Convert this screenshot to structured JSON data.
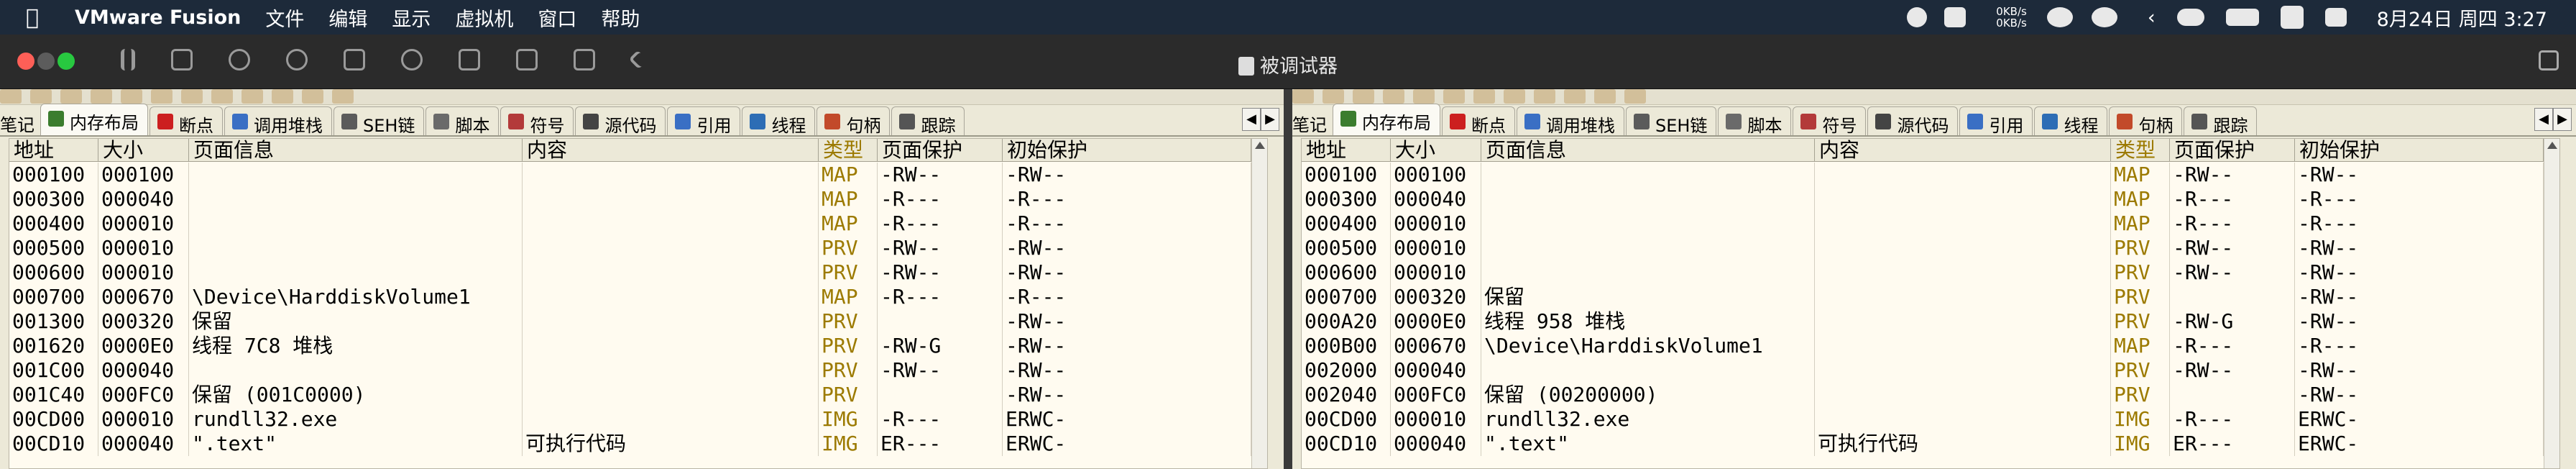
{
  "menubar": {
    "app_name": "VMware Fusion",
    "items": [
      "文件",
      "编辑",
      "显示",
      "虚拟机",
      "窗口",
      "帮助"
    ],
    "net_up": "0KB/s",
    "net_down": "0KB/s",
    "clock": "8月24日 周四 3:27"
  },
  "window": {
    "title": "被调试器"
  },
  "panels": [
    {
      "first_tab_label": "笔记",
      "tabs": [
        {
          "label": "内存布局",
          "active": true,
          "icon": "memory-icon",
          "color": "#3b7d2e"
        },
        {
          "label": "断点",
          "active": false,
          "icon": "breakpoint-icon",
          "color": "#cc1f1f"
        },
        {
          "label": "调用堆栈",
          "active": false,
          "icon": "callstack-icon",
          "color": "#3a6fc4"
        },
        {
          "label": "SEH链",
          "active": false,
          "icon": "seh-icon",
          "color": "#5b5b5b"
        },
        {
          "label": "脚本",
          "active": false,
          "icon": "script-icon",
          "color": "#6a6a6a"
        },
        {
          "label": "符号",
          "active": false,
          "icon": "symbol-icon",
          "color": "#b33a3a"
        },
        {
          "label": "源代码",
          "active": false,
          "icon": "source-icon",
          "color": "#444444"
        },
        {
          "label": "引用",
          "active": false,
          "icon": "reference-icon",
          "color": "#3a6fc4"
        },
        {
          "label": "线程",
          "active": false,
          "icon": "thread-icon",
          "color": "#2d6db5"
        },
        {
          "label": "句柄",
          "active": false,
          "icon": "handle-icon",
          "color": "#c24a2a"
        },
        {
          "label": "跟踪",
          "active": false,
          "icon": "trace-icon",
          "color": "#555555"
        }
      ],
      "columns": [
        "地址",
        "大小",
        "页面信息",
        "内容",
        "类型",
        "页面保护",
        "初始保护"
      ],
      "rows": [
        [
          "000100",
          "000100",
          "",
          "",
          "MAP",
          "-RW--",
          "-RW--"
        ],
        [
          "000300",
          "000040",
          "",
          "",
          "MAP",
          "-R---",
          "-R---"
        ],
        [
          "000400",
          "000010",
          "",
          "",
          "MAP",
          "-R---",
          "-R---"
        ],
        [
          "000500",
          "000010",
          "",
          "",
          "PRV",
          "-RW--",
          "-RW--"
        ],
        [
          "000600",
          "000010",
          "",
          "",
          "PRV",
          "-RW--",
          "-RW--"
        ],
        [
          "000700",
          "000670",
          "\\Device\\HarddiskVolume1",
          "",
          "MAP",
          "-R---",
          "-R---"
        ],
        [
          "001300",
          "000320",
          "保留",
          "",
          "PRV",
          "",
          "-RW--"
        ],
        [
          "001620",
          "0000E0",
          "线程 7C8 堆栈",
          "",
          "PRV",
          "-RW-G",
          "-RW--"
        ],
        [
          "001C00",
          "000040",
          "",
          "",
          "PRV",
          "-RW--",
          "-RW--"
        ],
        [
          "001C40",
          "000FC0",
          "保留 (001C0000)",
          "",
          "PRV",
          "",
          "-RW--"
        ],
        [
          "00CD00",
          "000010",
          "rundll32.exe",
          "",
          "IMG",
          "-R---",
          "ERWC-"
        ],
        [
          "00CD10",
          "000040",
          " \".text\"",
          "可执行代码",
          "IMG",
          "ER---",
          "ERWC-"
        ]
      ]
    },
    {
      "first_tab_label": "笔记",
      "tabs": [
        {
          "label": "内存布局",
          "active": true,
          "icon": "memory-icon",
          "color": "#3b7d2e"
        },
        {
          "label": "断点",
          "active": false,
          "icon": "breakpoint-icon",
          "color": "#cc1f1f"
        },
        {
          "label": "调用堆栈",
          "active": false,
          "icon": "callstack-icon",
          "color": "#3a6fc4"
        },
        {
          "label": "SEH链",
          "active": false,
          "icon": "seh-icon",
          "color": "#5b5b5b"
        },
        {
          "label": "脚本",
          "active": false,
          "icon": "script-icon",
          "color": "#6a6a6a"
        },
        {
          "label": "符号",
          "active": false,
          "icon": "symbol-icon",
          "color": "#b33a3a"
        },
        {
          "label": "源代码",
          "active": false,
          "icon": "source-icon",
          "color": "#444444"
        },
        {
          "label": "引用",
          "active": false,
          "icon": "reference-icon",
          "color": "#3a6fc4"
        },
        {
          "label": "线程",
          "active": false,
          "icon": "thread-icon",
          "color": "#2d6db5"
        },
        {
          "label": "句柄",
          "active": false,
          "icon": "handle-icon",
          "color": "#c24a2a"
        },
        {
          "label": "跟踪",
          "active": false,
          "icon": "trace-icon",
          "color": "#555555"
        }
      ],
      "columns": [
        "地址",
        "大小",
        "页面信息",
        "内容",
        "类型",
        "页面保护",
        "初始保护"
      ],
      "rows": [
        [
          "000100",
          "000100",
          "",
          "",
          "MAP",
          "-RW--",
          "-RW--"
        ],
        [
          "000300",
          "000040",
          "",
          "",
          "MAP",
          "-R---",
          "-R---"
        ],
        [
          "000400",
          "000010",
          "",
          "",
          "MAP",
          "-R---",
          "-R---"
        ],
        [
          "000500",
          "000010",
          "",
          "",
          "PRV",
          "-RW--",
          "-RW--"
        ],
        [
          "000600",
          "000010",
          "",
          "",
          "PRV",
          "-RW--",
          "-RW--"
        ],
        [
          "000700",
          "000320",
          "保留",
          "",
          "PRV",
          "",
          "-RW--"
        ],
        [
          "000A20",
          "0000E0",
          "线程 958 堆栈",
          "",
          "PRV",
          "-RW-G",
          "-RW--"
        ],
        [
          "000B00",
          "000670",
          "\\Device\\HarddiskVolume1",
          "",
          "MAP",
          "-R---",
          "-R---"
        ],
        [
          "002000",
          "000040",
          "",
          "",
          "PRV",
          "-RW--",
          "-RW--"
        ],
        [
          "002040",
          "000FC0",
          "保留 (00200000)",
          "",
          "PRV",
          "",
          "-RW--"
        ],
        [
          "00CD00",
          "000010",
          "rundll32.exe",
          "",
          "IMG",
          "-R---",
          "ERWC-"
        ],
        [
          "00CD10",
          "000040",
          " \".text\"",
          "可执行代码",
          "IMG",
          "ER---",
          "ERWC-"
        ]
      ]
    }
  ],
  "colors": {
    "type_text": "#9c7a00",
    "grid_bg": "#fffbf0",
    "chrome_bg": "#ece9d8"
  }
}
